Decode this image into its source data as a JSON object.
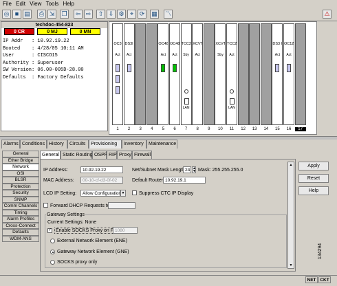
{
  "menu": [
    "File",
    "Edit",
    "View",
    "Tools",
    "Help"
  ],
  "node": {
    "name": "techdoc-454-823",
    "alarms": {
      "cr": "0 CR",
      "mj": "0 MJ",
      "mn": "0 MN"
    },
    "colors": {
      "cr": "#d00000",
      "mj": "#ffff00",
      "mn": "#ffff00"
    },
    "info_lines": [
      "IP Addr   : 10.92.19.22",
      "Booted    : 4/28/05 10:11 AM",
      "User      : CISCO15",
      "Authority : Superuser",
      "SW Version: 06.00-005D-28.00",
      "Defaults  : Factory Defaults"
    ]
  },
  "shelf": {
    "slots": [
      {
        "num": "1",
        "name": "OC3",
        "status": "Act",
        "type": "card"
      },
      {
        "num": "2",
        "name": "DS3I",
        "status": "Act",
        "type": "card"
      },
      {
        "num": "3",
        "name": "",
        "status": "",
        "type": "blank"
      },
      {
        "num": "4",
        "name": "",
        "status": "",
        "type": "blank"
      },
      {
        "num": "5",
        "name": "OC48",
        "status": "Act",
        "type": "card"
      },
      {
        "num": "6",
        "name": "OC48",
        "status": "Act",
        "type": "card"
      },
      {
        "num": "7",
        "name": "TCC2",
        "status": "Sby",
        "type": "card"
      },
      {
        "num": "8",
        "name": "XCVT",
        "status": "Act",
        "type": "card"
      },
      {
        "num": "9",
        "name": "",
        "status": "",
        "type": "blank"
      },
      {
        "num": "10",
        "name": "XCVT",
        "status": "Sby",
        "type": "card"
      },
      {
        "num": "11",
        "name": "TCC2",
        "status": "Act",
        "type": "card"
      },
      {
        "num": "12",
        "name": "",
        "status": "",
        "type": "blank"
      },
      {
        "num": "13",
        "name": "",
        "status": "",
        "type": "blank"
      },
      {
        "num": "14",
        "name": "",
        "status": "",
        "type": "blank"
      },
      {
        "num": "15",
        "name": "DS3 IN",
        "status": "Act",
        "type": "card"
      },
      {
        "num": "16",
        "name": "OC12",
        "status": "Act",
        "type": "card"
      },
      {
        "num": "17",
        "name": "",
        "status": "",
        "type": "blank"
      }
    ],
    "lan_label": "LAN"
  },
  "main_tabs": [
    "Alarms",
    "Conditions",
    "History",
    "Circuits",
    "Provisioning",
    "Inventory",
    "Maintenance"
  ],
  "active_main_tab": "Provisioning",
  "left_nav": [
    "General",
    "Ether Bridge",
    "Network",
    "OSI",
    "BLSR",
    "Protection",
    "Security",
    "SNMP",
    "Comm Channels",
    "Timing",
    "Alarm Profiles",
    "Cross-Connect",
    "Defaults",
    "WDM-ANS"
  ],
  "selected_left_nav": "Network",
  "sub_tabs": [
    "General",
    "Static Routing",
    "OSPF",
    "RIP",
    "Proxy",
    "Firewall"
  ],
  "active_sub_tab": "General",
  "form": {
    "ip_label": "IP Address:",
    "ip_value": "10.92.19.22",
    "mask_label": "Net/Subnet Mask Length:",
    "mask_value": "24",
    "mask_text": "Mask: 255.255.255.0",
    "mac_label": "MAC Address:",
    "mac_value": "00-10-cf-d3-0f-02",
    "router_label": "Default Router:",
    "router_value": "10.92.19.1",
    "lcd_label": "LCD IP Setting:",
    "lcd_value": "Allow Configuration",
    "suppress_label": "Suppress CTC IP Display",
    "forward_label": "Forward DHCP Requests to:",
    "gateway_title": "Gateway Settings",
    "current_settings": "Current Settings: None",
    "socks_label": "Enable SOCKS Proxy on Port:",
    "socks_port": "1080",
    "ene_label": "External Network Element (ENE)",
    "gne_label": "Gateway Network Element (GNE)",
    "socks_only_label": "SOCKS proxy only"
  },
  "buttons": {
    "apply": "Apply",
    "reset": "Reset",
    "help": "Help"
  },
  "status": {
    "net": "NET",
    "ckt": "CKT"
  },
  "figure_id": "134294"
}
